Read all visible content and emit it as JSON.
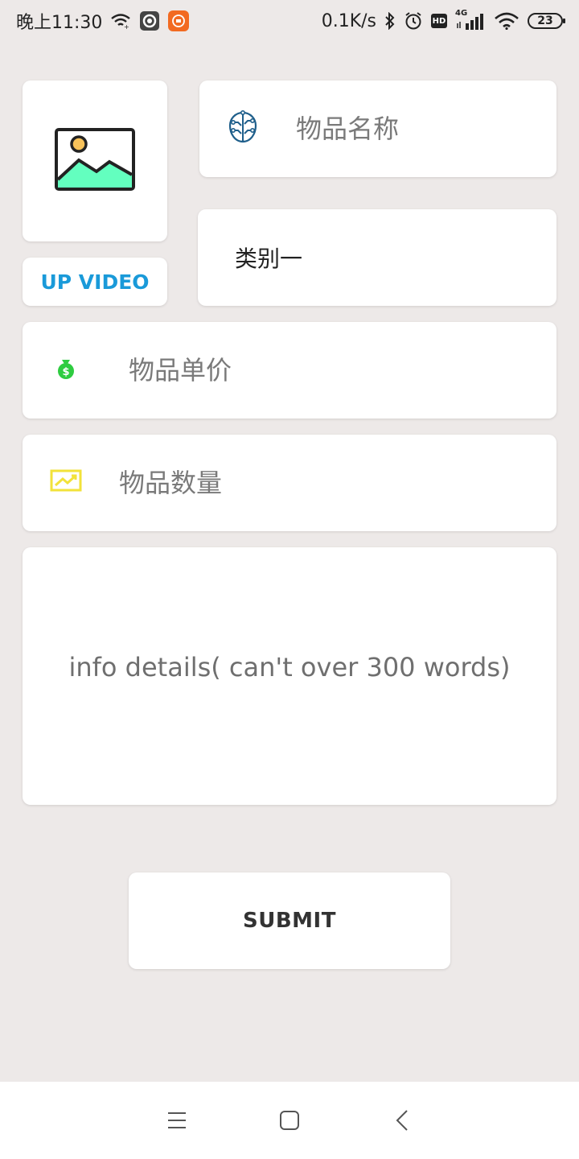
{
  "status_bar": {
    "time": "晚上11:30",
    "net_speed": "0.1K/s",
    "network_type": "4G",
    "hd_label": "HD",
    "battery": "23",
    "left_icons": [
      "wifi-calling-icon",
      "record-icon",
      "mi-app-icon"
    ],
    "right_icons": [
      "bluetooth-icon",
      "alarm-icon",
      "hd-icon",
      "signal-icon",
      "wifi-icon",
      "battery-icon"
    ]
  },
  "form": {
    "photo_icon": "image-placeholder-icon",
    "up_video_label": "UP VIDEO",
    "name": {
      "icon": "brain-circuit-icon",
      "placeholder": "物品名称",
      "value": ""
    },
    "category": {
      "value": "类别一"
    },
    "price": {
      "icon": "money-bag-icon",
      "placeholder": "物品单价",
      "value": ""
    },
    "quantity": {
      "icon": "trend-chart-icon",
      "placeholder": "物品数量",
      "value": ""
    },
    "details": {
      "placeholder": "info details( can't over 300 words)",
      "value": ""
    },
    "submit_label": "SUBMIT"
  },
  "nav_bar": {
    "icons": [
      "menu-icon",
      "home-square-icon",
      "back-chevron-icon"
    ]
  },
  "colors": {
    "background": "#ede9e8",
    "accent_blue": "#1a9ad9",
    "money_green": "#2ecc40",
    "chart_yellow": "#f2e23a",
    "image_green": "#63ffbf",
    "image_sun": "#f7c25a",
    "circuit_blue": "#1f5f8b",
    "mi_orange": "#f26a21"
  }
}
